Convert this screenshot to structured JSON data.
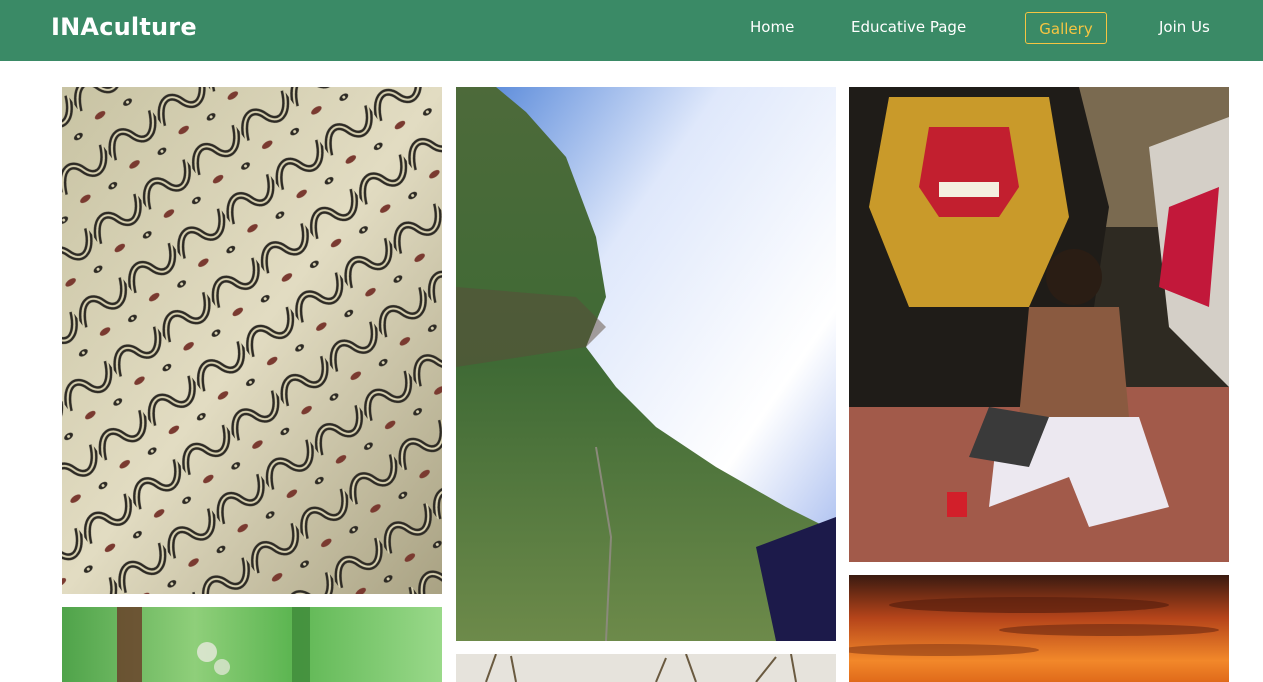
{
  "navbar": {
    "brand": "INAculture",
    "links": [
      {
        "label": "Home",
        "active": false
      },
      {
        "label": "Educative Page",
        "active": false
      },
      {
        "label": "Gallery",
        "active": true
      },
      {
        "label": "Join Us",
        "active": false
      }
    ]
  },
  "colors": {
    "navbar_bg": "#3a8a66",
    "active_accent": "#f5c542",
    "text": "#ffffff"
  },
  "gallery": {
    "photos": [
      {
        "subject": "batik-fabric"
      },
      {
        "subject": "mountain-sea-of-clouds"
      },
      {
        "subject": "barong-dance"
      },
      {
        "subject": "green-plants"
      },
      {
        "subject": "dry-grass-field"
      },
      {
        "subject": "sunset-sky"
      }
    ]
  }
}
